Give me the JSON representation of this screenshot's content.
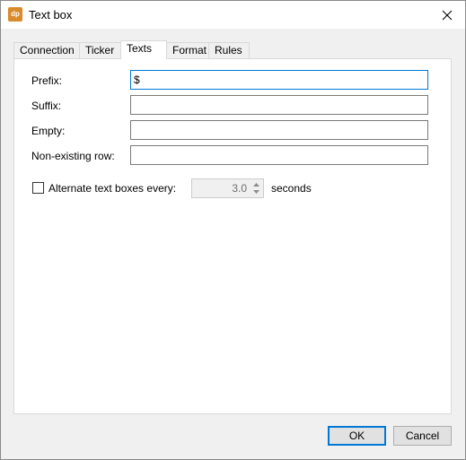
{
  "window": {
    "title": "Text box",
    "app_icon_text": "dp",
    "accent_color": "#0078d7"
  },
  "tabs": [
    {
      "label": "Connection",
      "active": false
    },
    {
      "label": "Ticker",
      "active": false
    },
    {
      "label": "Texts",
      "active": true
    },
    {
      "label": "Format",
      "active": false
    },
    {
      "label": "Rules",
      "active": false
    }
  ],
  "fields": {
    "prefix": {
      "label": "Prefix:",
      "value": "$"
    },
    "suffix": {
      "label": "Suffix:",
      "value": ""
    },
    "empty": {
      "label": "Empty:",
      "value": ""
    },
    "non_existing": {
      "label": "Non-existing row:",
      "value": ""
    }
  },
  "alternate": {
    "label": "Alternate text boxes every:",
    "checked": false,
    "value": "3.0",
    "unit": "seconds"
  },
  "buttons": {
    "ok": "OK",
    "cancel": "Cancel"
  }
}
